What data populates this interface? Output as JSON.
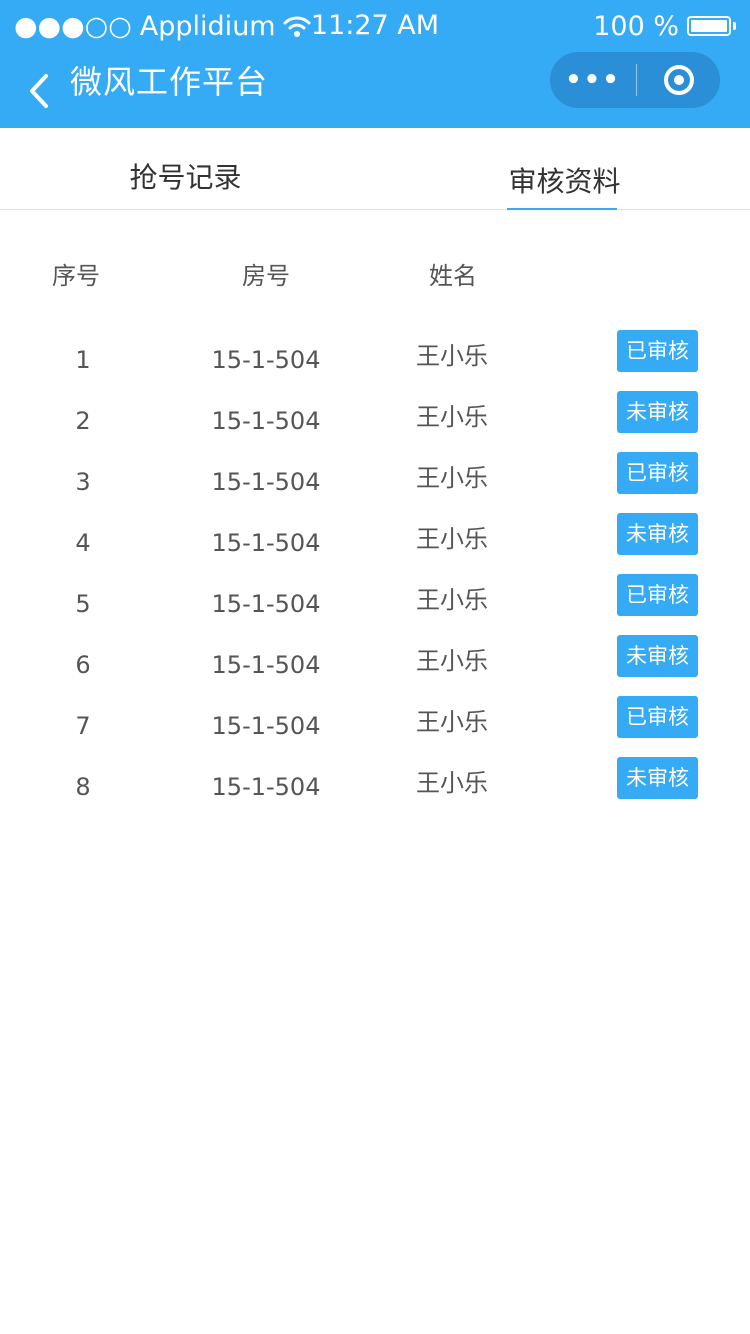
{
  "status_bar": {
    "signal": "●●●○○",
    "carrier": "Applidium",
    "time": "11:27 AM",
    "battery": "100 %"
  },
  "nav": {
    "title": "微风工作平台",
    "more_label": "•••"
  },
  "tabs": [
    {
      "label": "抢号记录",
      "active": false
    },
    {
      "label": "审核资料",
      "active": true
    }
  ],
  "table": {
    "headers": [
      "序号",
      "房号",
      "姓名",
      ""
    ],
    "rows": [
      {
        "index": "1",
        "room": "15-1-504",
        "name": "王小乐",
        "status": "已审核"
      },
      {
        "index": "2",
        "room": "15-1-504",
        "name": "王小乐",
        "status": "未审核"
      },
      {
        "index": "3",
        "room": "15-1-504",
        "name": "王小乐",
        "status": "已审核"
      },
      {
        "index": "4",
        "room": "15-1-504",
        "name": "王小乐",
        "status": "未审核"
      },
      {
        "index": "5",
        "room": "15-1-504",
        "name": "王小乐",
        "status": "已审核"
      },
      {
        "index": "6",
        "room": "15-1-504",
        "name": "王小乐",
        "status": "未审核"
      },
      {
        "index": "7",
        "room": "15-1-504",
        "name": "王小乐",
        "status": "已审核"
      },
      {
        "index": "8",
        "room": "15-1-504",
        "name": "王小乐",
        "status": "未审核"
      }
    ]
  },
  "colors": {
    "accent": "#35aaf5",
    "capsule": "#2a8fd6",
    "text": "#555555"
  }
}
